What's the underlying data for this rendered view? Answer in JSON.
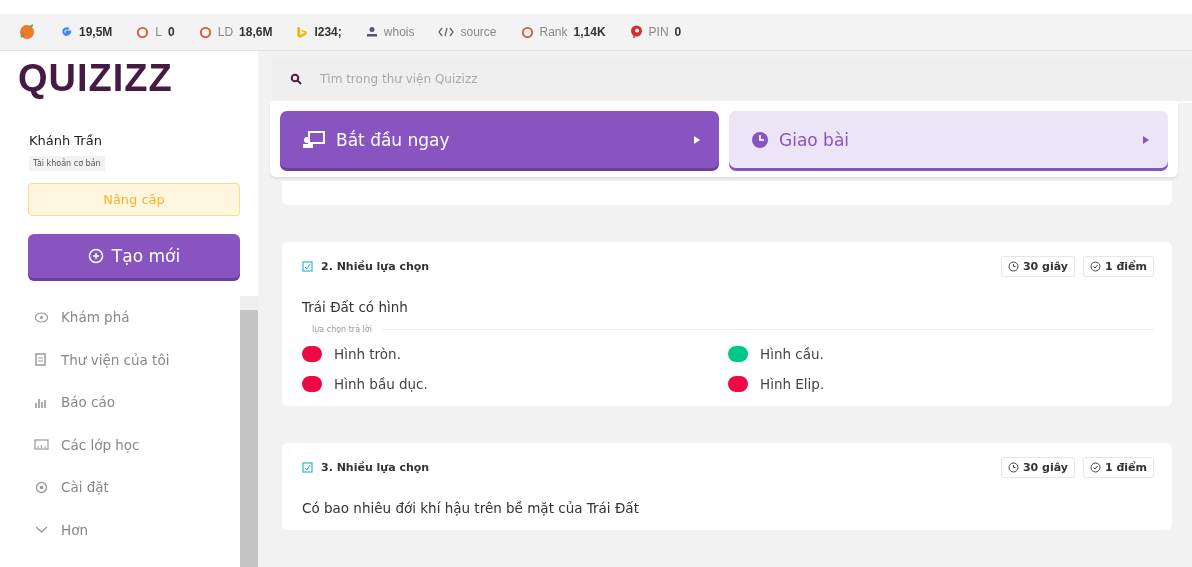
{
  "toolbar": [
    {
      "value": "19,5M"
    },
    {
      "label": "L",
      "value": "0"
    },
    {
      "label": "LD",
      "value": "18,6M"
    },
    {
      "value": "I234;"
    },
    {
      "label": "whois"
    },
    {
      "label": "source"
    },
    {
      "label": "Rank",
      "value": "1,14K"
    },
    {
      "label": "PIN",
      "value": "0"
    }
  ],
  "sidebar": {
    "logo": "QUIZIZZ",
    "user": "Khánh Trần",
    "account": "Tài khoản cơ bản",
    "upgrade": "Nâng cấp",
    "create": "Tạo mới",
    "items": [
      {
        "label": "Khám phá"
      },
      {
        "label": "Thư viện của tôi"
      },
      {
        "label": "Báo cáo"
      },
      {
        "label": "Các lớp học"
      },
      {
        "label": "Cài đặt"
      },
      {
        "label": "Hơn"
      }
    ]
  },
  "search": {
    "placeholder": "Tìm trong thư viện Quizizz"
  },
  "actions": [
    {
      "kind": "primary",
      "label": "Bắt đầu ngay"
    },
    {
      "kind": "secondary",
      "label": "Giao bài"
    }
  ],
  "questions": [
    {
      "title": "2. Nhiều lựa chọn",
      "time": "30 giây",
      "points": "1 điểm",
      "text": "Trái Đất có hình",
      "choices_label": "lựa chọn trả lời",
      "choices": [
        {
          "text": "Hình tròn.",
          "correct": false
        },
        {
          "text": "Hình cầu.",
          "correct": true
        },
        {
          "text": "Hình bầu dục.",
          "correct": false
        },
        {
          "text": "Hình Elip.",
          "correct": false
        }
      ]
    },
    {
      "title": "3. Nhiều lựa chọn",
      "time": "30 giây",
      "points": "1 điểm",
      "text": "Có bao nhiêu đới khí hậu trên bề mặt của Trái Đất"
    }
  ]
}
